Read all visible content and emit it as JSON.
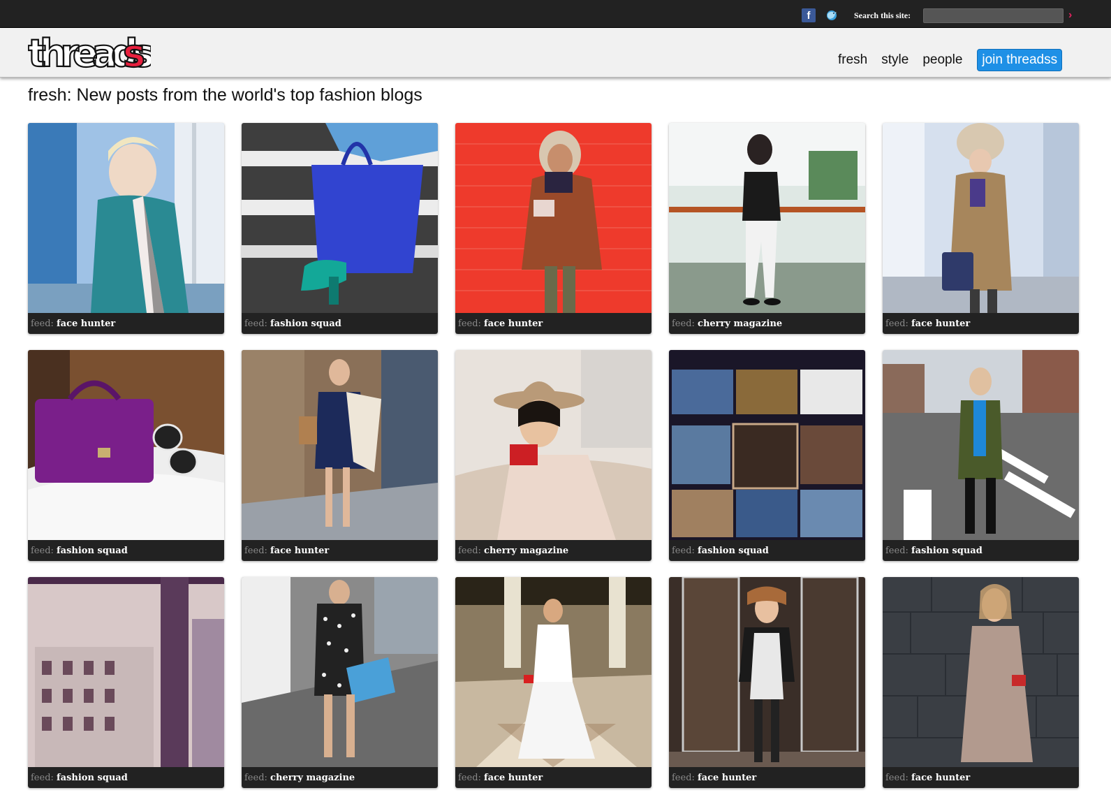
{
  "topbar": {
    "facebook_icon": "facebook-icon",
    "twitter_icon": "twitter-bird-icon",
    "search_label": "Search this site:",
    "search_placeholder": "",
    "search_go_icon": "chevron-right-icon",
    "accent_color": "#e0245e"
  },
  "header": {
    "logo_text": "threadss",
    "nav": [
      {
        "label": "fresh"
      },
      {
        "label": "style"
      },
      {
        "label": "people"
      }
    ],
    "join_label": "join threadss",
    "join_color": "#1e90e6"
  },
  "page": {
    "title": "fresh: New posts from the world's top fashion blogs"
  },
  "caption_prefix": "feed:",
  "posts": [
    {
      "feed": "face hunter",
      "scene": "blonde woman, teal fringe jacket, window",
      "colors": [
        "#4a86c2",
        "#2e8f98",
        "#f0f0f0"
      ]
    },
    {
      "feed": "fashion squad",
      "scene": "blue tote bag, teal heels, crosswalk",
      "colors": [
        "#3b4ad6",
        "#3a3a3a",
        "#1aa39a"
      ]
    },
    {
      "feed": "face hunter",
      "scene": "woman in rust parka, red wall",
      "colors": [
        "#ee3a2c",
        "#9a4a2a",
        "#6a6a4a"
      ]
    },
    {
      "feed": "cherry magazine",
      "scene": "woman in white jeans, glass railing",
      "colors": [
        "#cfd8d4",
        "#a5481a",
        "#f2f2f2"
      ]
    },
    {
      "feed": "face hunter",
      "scene": "woman in fur hat, camel coat",
      "colors": [
        "#c9d6e6",
        "#a7865c",
        "#2f3a6a"
      ]
    },
    {
      "feed": "fashion squad",
      "scene": "purple satchel on white fur",
      "colors": [
        "#4a3020",
        "#7a1f8a",
        "#eeeeee"
      ]
    },
    {
      "feed": "face hunter",
      "scene": "woman in navy dress, white cardigan",
      "colors": [
        "#8a7058",
        "#1c2a5a",
        "#eee6d8"
      ]
    },
    {
      "feed": "cherry magazine",
      "scene": "woman in fedora, red scarf",
      "colors": [
        "#e8e2dc",
        "#b99a78",
        "#cc1f24"
      ]
    },
    {
      "feed": "fashion squad",
      "scene": "instagram collage",
      "colors": [
        "#1a1628",
        "#8a6a3a",
        "#3a5a8a"
      ]
    },
    {
      "feed": "fashion squad",
      "scene": "woman in olive jacket, crosswalk",
      "colors": [
        "#6c6c6c",
        "#4a5a2a",
        "#ffffff"
      ]
    },
    {
      "feed": "fashion squad",
      "scene": "city buildings, purple tint",
      "colors": [
        "#a08aa0",
        "#5a3a5a",
        "#d8c8c8"
      ]
    },
    {
      "feed": "cherry magazine",
      "scene": "woman in polka dot dress, blue clutch",
      "colors": [
        "#6a6a6a",
        "#222222",
        "#4aa0d8"
      ]
    },
    {
      "feed": "face hunter",
      "scene": "woman in white dress, marble floor",
      "colors": [
        "#c8b8a0",
        "#ffffff",
        "#a08060"
      ]
    },
    {
      "feed": "face hunter",
      "scene": "woman in leather jacket, glass door",
      "colors": [
        "#3a2e28",
        "#1a1a1a",
        "#e8e8e8"
      ]
    },
    {
      "feed": "face hunter",
      "scene": "woman in long coat, stone wall",
      "colors": [
        "#3a3e44",
        "#b29a8e",
        "#c8a0a0"
      ]
    }
  ]
}
